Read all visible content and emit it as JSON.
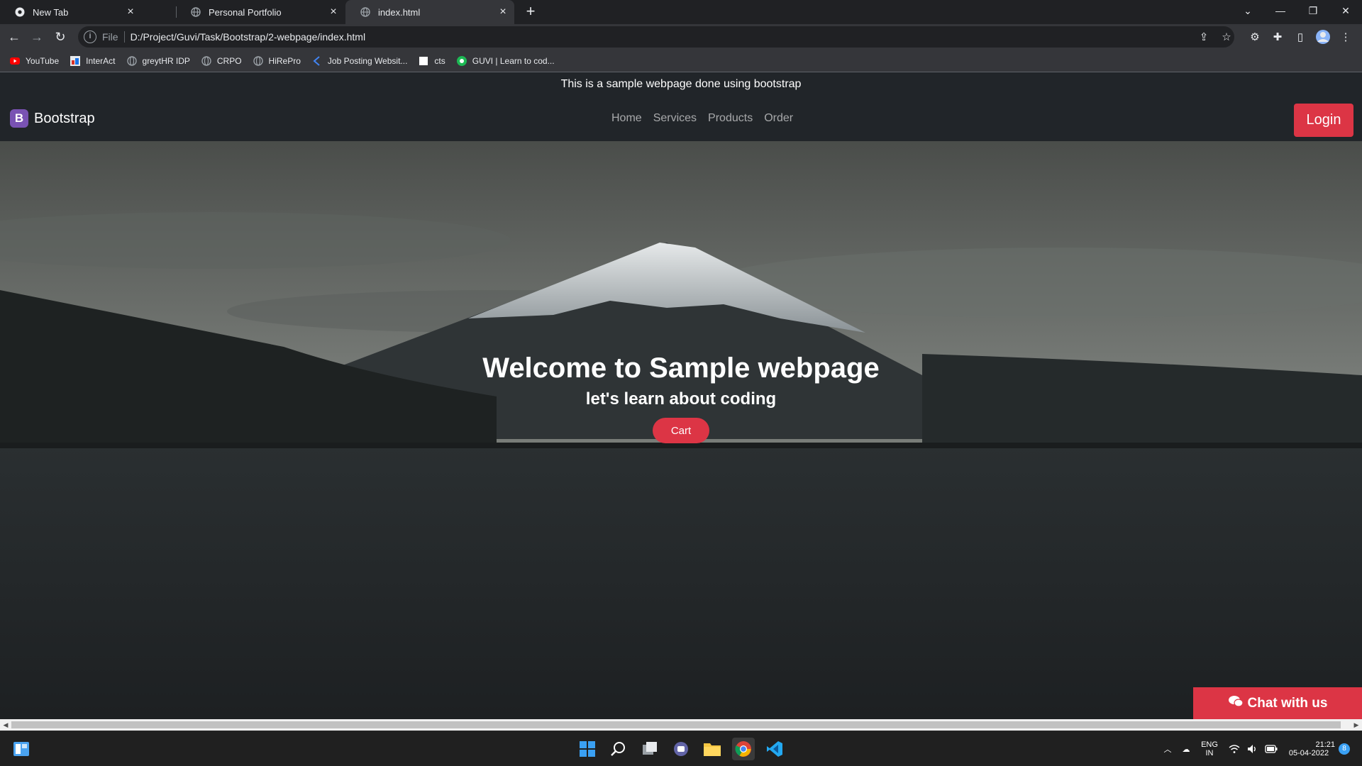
{
  "browser": {
    "tabs": [
      {
        "title": "New Tab",
        "icon": "chrome-icon"
      },
      {
        "title": "Personal Portfolio",
        "icon": "globe-icon"
      },
      {
        "title": "index.html",
        "icon": "globe-icon",
        "active": true
      }
    ],
    "address": {
      "scheme_label": "File",
      "url": "D:/Project/Guvi/Task/Bootstrap/2-webpage/index.html"
    },
    "bookmarks": [
      {
        "label": "YouTube",
        "icon": "youtube-icon"
      },
      {
        "label": "InterAct",
        "icon": "interact-icon"
      },
      {
        "label": "greytHR IDP",
        "icon": "globe-icon"
      },
      {
        "label": "CRPO",
        "icon": "globe-icon"
      },
      {
        "label": "HiRePro",
        "icon": "globe-icon"
      },
      {
        "label": "Job Posting Websit...",
        "icon": "job-icon"
      },
      {
        "label": "cts",
        "icon": "page-icon"
      },
      {
        "label": "GUVI | Learn to cod...",
        "icon": "guvi-icon"
      }
    ]
  },
  "page": {
    "topbar_text": "This is a sample webpage done using bootstrap",
    "brand": {
      "logo_letter": "B",
      "name": "Bootstrap"
    },
    "nav": [
      "Home",
      "Services",
      "Products",
      "Order"
    ],
    "login_label": "Login",
    "hero": {
      "title": "Welcome to Sample webpage",
      "subtitle": "let's learn about coding",
      "cart_label": "Cart"
    },
    "chat_label": "Chat with us"
  },
  "taskbar": {
    "lang_top": "ENG",
    "lang_bottom": "IN",
    "time": "21:21",
    "date": "05-04-2022",
    "notification_count": "8"
  },
  "colors": {
    "accent_red": "#dc3545",
    "brand_purple": "#7952b3",
    "navbar_bg": "#212529"
  }
}
